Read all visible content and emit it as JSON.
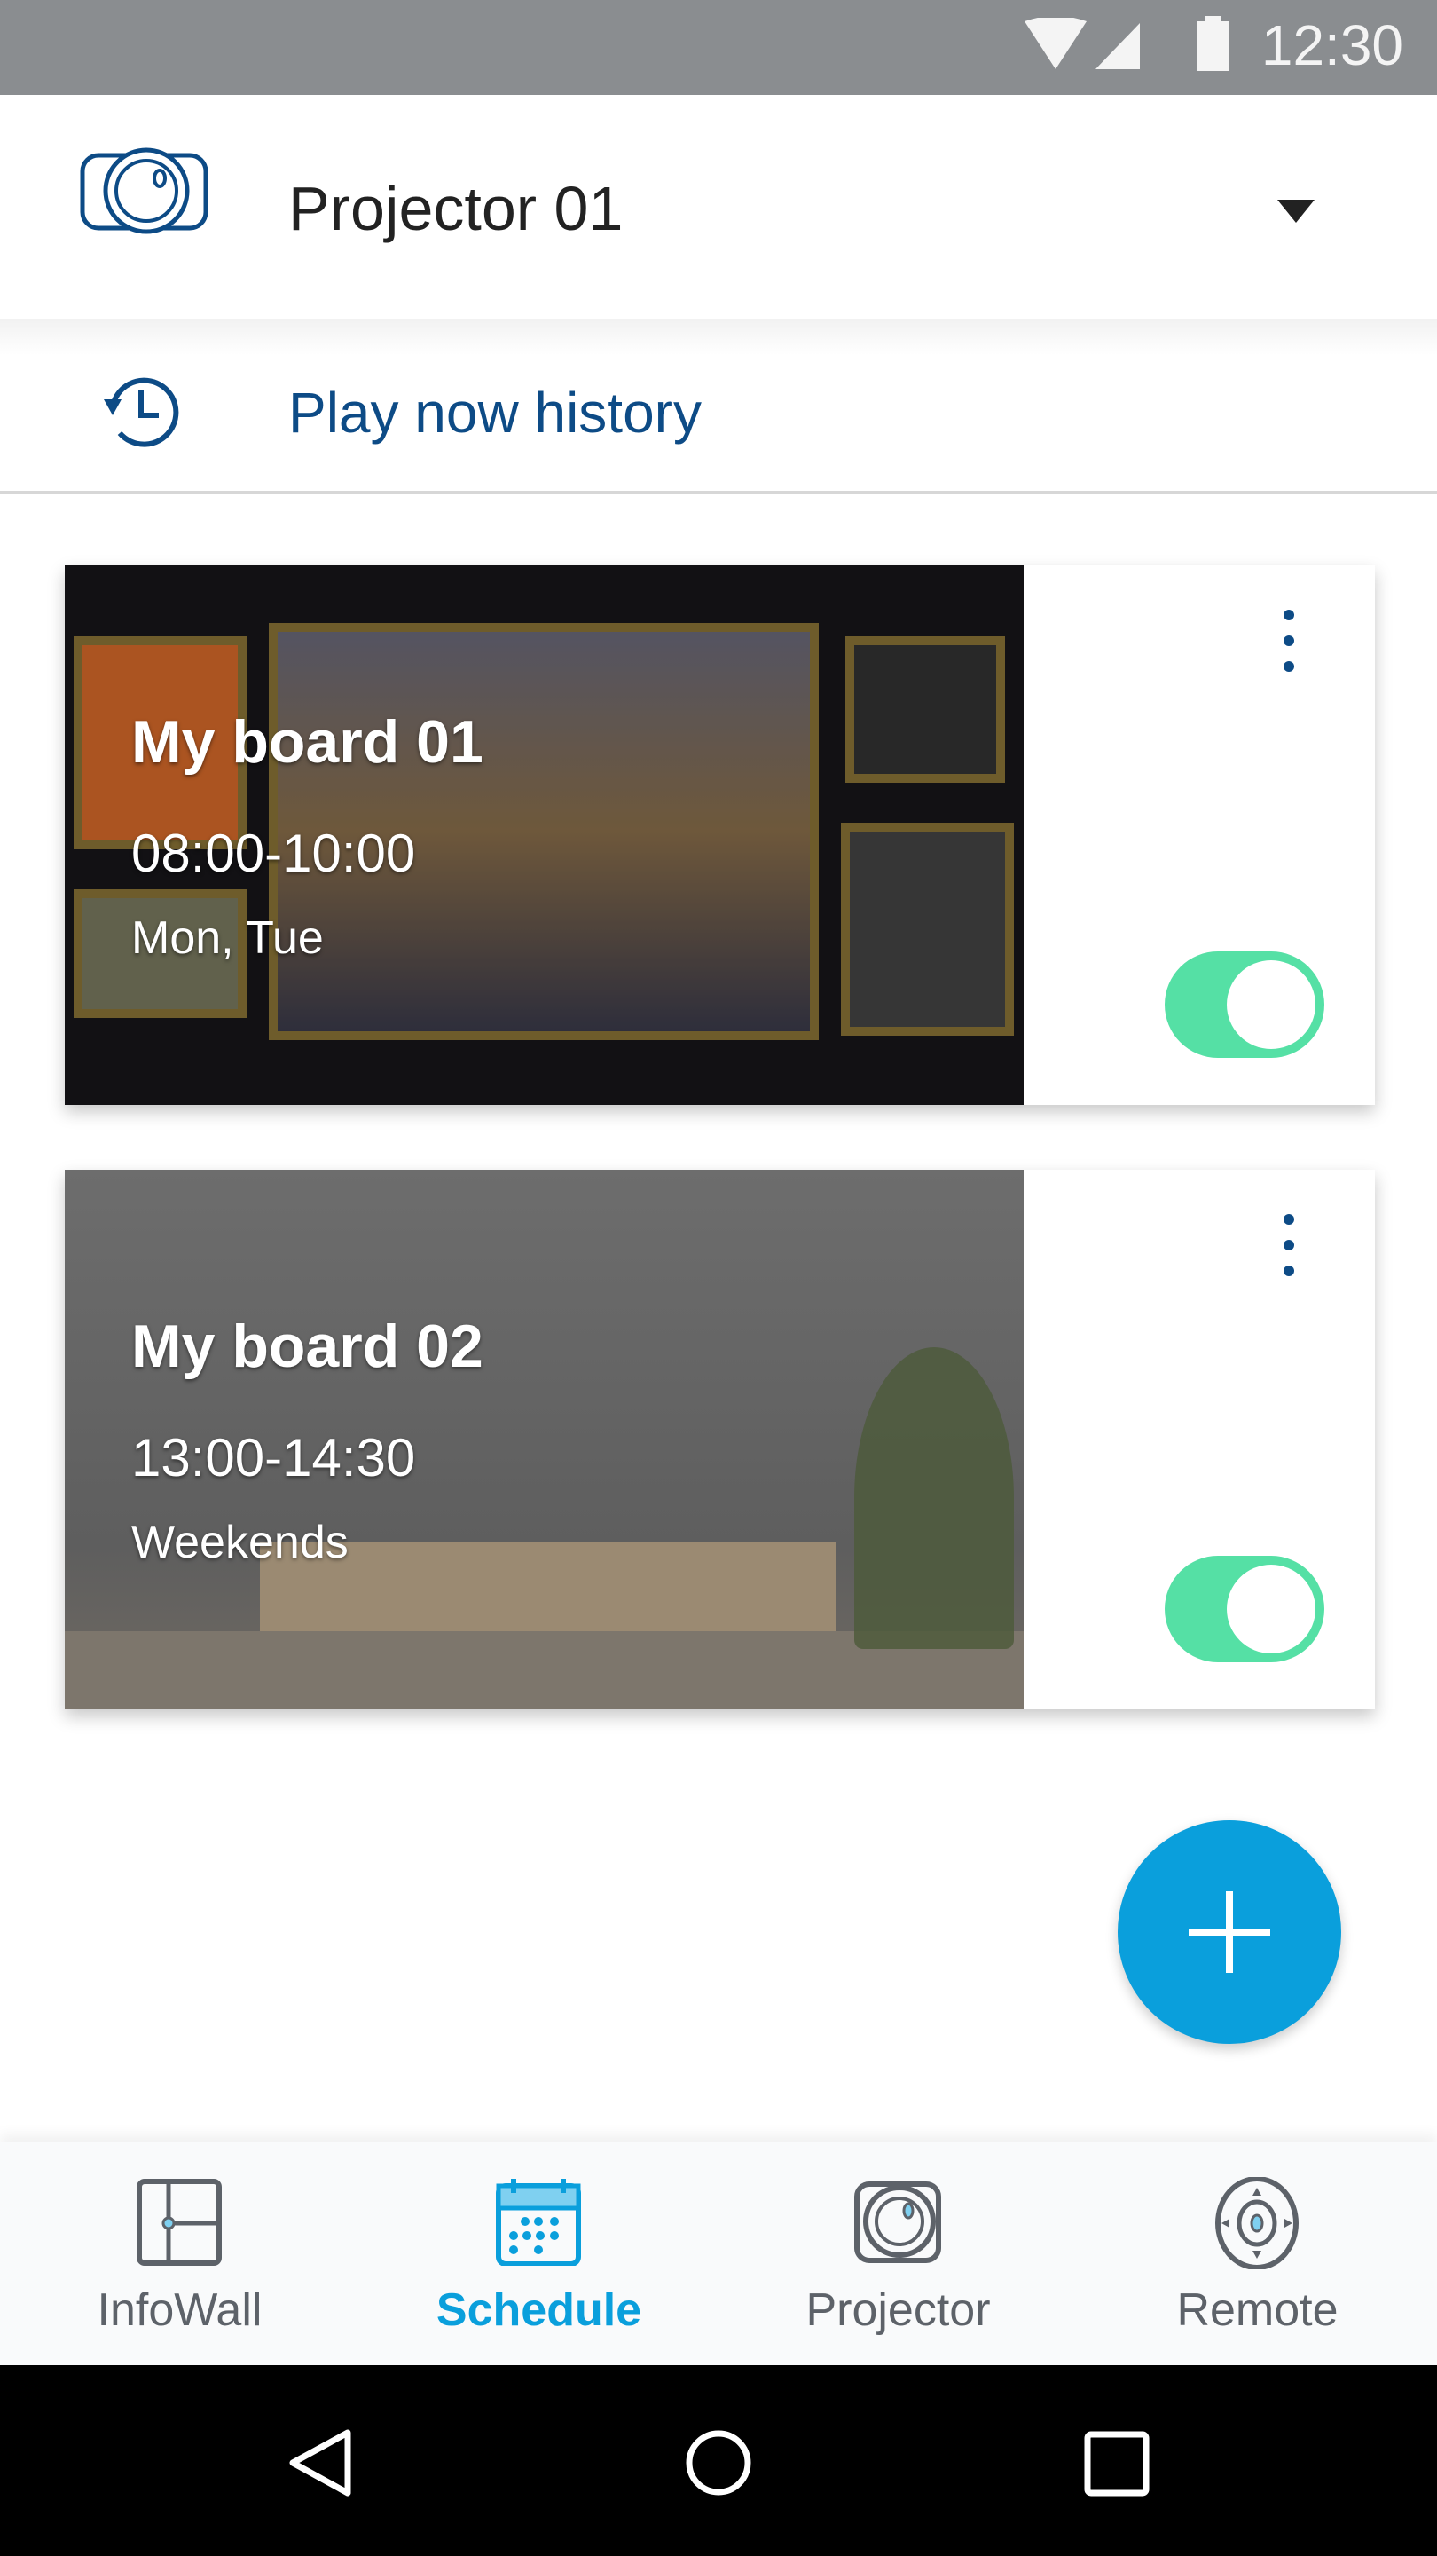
{
  "status_bar": {
    "time": "12:30",
    "icons": [
      "wifi-icon",
      "signal-icon",
      "battery-icon"
    ]
  },
  "header": {
    "device_name": "Projector 01",
    "icon": "projector-icon",
    "dropdown_icon": "triangle-down-icon"
  },
  "history": {
    "label": "Play now history",
    "icon": "history-icon"
  },
  "boards": [
    {
      "name": "My board 01",
      "time": "08:00-10:00",
      "days": "Mon, Tue",
      "enabled": true
    },
    {
      "name": "My board 02",
      "time": "13:00-14:30",
      "days": "Weekends",
      "enabled": true
    }
  ],
  "fab": {
    "icon": "plus-icon"
  },
  "bottom_nav": {
    "items": [
      {
        "label": "InfoWall",
        "icon": "infowall-icon",
        "active": false
      },
      {
        "label": "Schedule",
        "icon": "calendar-icon",
        "active": true
      },
      {
        "label": "Projector",
        "icon": "projector-icon",
        "active": false
      },
      {
        "label": "Remote",
        "icon": "remote-icon",
        "active": false
      }
    ]
  },
  "colors": {
    "accent": "#0a9fdc",
    "primary": "#0d4b86",
    "toggle_on": "#55e0a5",
    "status_bar": "#8a8d90"
  }
}
